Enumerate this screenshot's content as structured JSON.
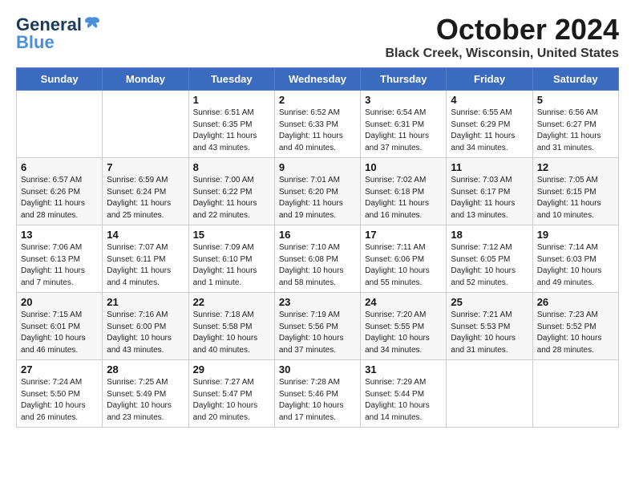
{
  "logo": {
    "general": "General",
    "blue": "Blue",
    "tagline": "BLUE"
  },
  "header": {
    "month": "October 2024",
    "location": "Black Creek, Wisconsin, United States"
  },
  "weekdays": [
    "Sunday",
    "Monday",
    "Tuesday",
    "Wednesday",
    "Thursday",
    "Friday",
    "Saturday"
  ],
  "weeks": [
    [
      {
        "day": "",
        "info": ""
      },
      {
        "day": "",
        "info": ""
      },
      {
        "day": "1",
        "info": "Sunrise: 6:51 AM\nSunset: 6:35 PM\nDaylight: 11 hours\nand 43 minutes."
      },
      {
        "day": "2",
        "info": "Sunrise: 6:52 AM\nSunset: 6:33 PM\nDaylight: 11 hours\nand 40 minutes."
      },
      {
        "day": "3",
        "info": "Sunrise: 6:54 AM\nSunset: 6:31 PM\nDaylight: 11 hours\nand 37 minutes."
      },
      {
        "day": "4",
        "info": "Sunrise: 6:55 AM\nSunset: 6:29 PM\nDaylight: 11 hours\nand 34 minutes."
      },
      {
        "day": "5",
        "info": "Sunrise: 6:56 AM\nSunset: 6:27 PM\nDaylight: 11 hours\nand 31 minutes."
      }
    ],
    [
      {
        "day": "6",
        "info": "Sunrise: 6:57 AM\nSunset: 6:26 PM\nDaylight: 11 hours\nand 28 minutes."
      },
      {
        "day": "7",
        "info": "Sunrise: 6:59 AM\nSunset: 6:24 PM\nDaylight: 11 hours\nand 25 minutes."
      },
      {
        "day": "8",
        "info": "Sunrise: 7:00 AM\nSunset: 6:22 PM\nDaylight: 11 hours\nand 22 minutes."
      },
      {
        "day": "9",
        "info": "Sunrise: 7:01 AM\nSunset: 6:20 PM\nDaylight: 11 hours\nand 19 minutes."
      },
      {
        "day": "10",
        "info": "Sunrise: 7:02 AM\nSunset: 6:18 PM\nDaylight: 11 hours\nand 16 minutes."
      },
      {
        "day": "11",
        "info": "Sunrise: 7:03 AM\nSunset: 6:17 PM\nDaylight: 11 hours\nand 13 minutes."
      },
      {
        "day": "12",
        "info": "Sunrise: 7:05 AM\nSunset: 6:15 PM\nDaylight: 11 hours\nand 10 minutes."
      }
    ],
    [
      {
        "day": "13",
        "info": "Sunrise: 7:06 AM\nSunset: 6:13 PM\nDaylight: 11 hours\nand 7 minutes."
      },
      {
        "day": "14",
        "info": "Sunrise: 7:07 AM\nSunset: 6:11 PM\nDaylight: 11 hours\nand 4 minutes."
      },
      {
        "day": "15",
        "info": "Sunrise: 7:09 AM\nSunset: 6:10 PM\nDaylight: 11 hours\nand 1 minute."
      },
      {
        "day": "16",
        "info": "Sunrise: 7:10 AM\nSunset: 6:08 PM\nDaylight: 10 hours\nand 58 minutes."
      },
      {
        "day": "17",
        "info": "Sunrise: 7:11 AM\nSunset: 6:06 PM\nDaylight: 10 hours\nand 55 minutes."
      },
      {
        "day": "18",
        "info": "Sunrise: 7:12 AM\nSunset: 6:05 PM\nDaylight: 10 hours\nand 52 minutes."
      },
      {
        "day": "19",
        "info": "Sunrise: 7:14 AM\nSunset: 6:03 PM\nDaylight: 10 hours\nand 49 minutes."
      }
    ],
    [
      {
        "day": "20",
        "info": "Sunrise: 7:15 AM\nSunset: 6:01 PM\nDaylight: 10 hours\nand 46 minutes."
      },
      {
        "day": "21",
        "info": "Sunrise: 7:16 AM\nSunset: 6:00 PM\nDaylight: 10 hours\nand 43 minutes."
      },
      {
        "day": "22",
        "info": "Sunrise: 7:18 AM\nSunset: 5:58 PM\nDaylight: 10 hours\nand 40 minutes."
      },
      {
        "day": "23",
        "info": "Sunrise: 7:19 AM\nSunset: 5:56 PM\nDaylight: 10 hours\nand 37 minutes."
      },
      {
        "day": "24",
        "info": "Sunrise: 7:20 AM\nSunset: 5:55 PM\nDaylight: 10 hours\nand 34 minutes."
      },
      {
        "day": "25",
        "info": "Sunrise: 7:21 AM\nSunset: 5:53 PM\nDaylight: 10 hours\nand 31 minutes."
      },
      {
        "day": "26",
        "info": "Sunrise: 7:23 AM\nSunset: 5:52 PM\nDaylight: 10 hours\nand 28 minutes."
      }
    ],
    [
      {
        "day": "27",
        "info": "Sunrise: 7:24 AM\nSunset: 5:50 PM\nDaylight: 10 hours\nand 26 minutes."
      },
      {
        "day": "28",
        "info": "Sunrise: 7:25 AM\nSunset: 5:49 PM\nDaylight: 10 hours\nand 23 minutes."
      },
      {
        "day": "29",
        "info": "Sunrise: 7:27 AM\nSunset: 5:47 PM\nDaylight: 10 hours\nand 20 minutes."
      },
      {
        "day": "30",
        "info": "Sunrise: 7:28 AM\nSunset: 5:46 PM\nDaylight: 10 hours\nand 17 minutes."
      },
      {
        "day": "31",
        "info": "Sunrise: 7:29 AM\nSunset: 5:44 PM\nDaylight: 10 hours\nand 14 minutes."
      },
      {
        "day": "",
        "info": ""
      },
      {
        "day": "",
        "info": ""
      }
    ]
  ]
}
